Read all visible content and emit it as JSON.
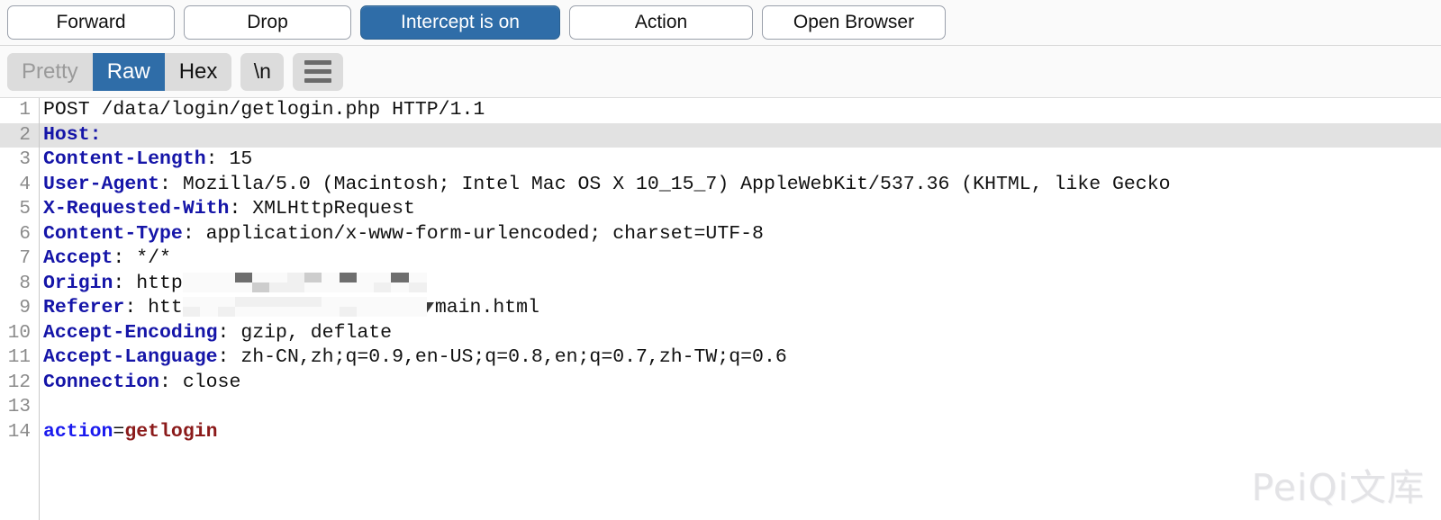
{
  "action_bar": {
    "buttons": [
      {
        "label": "Forward",
        "style": "default"
      },
      {
        "label": "Drop",
        "style": "default"
      },
      {
        "label": "Intercept is on",
        "style": "primary"
      },
      {
        "label": "Action",
        "style": "default"
      },
      {
        "label": "Open Browser",
        "style": "default"
      }
    ]
  },
  "view_bar": {
    "tabs": [
      {
        "label": "Pretty",
        "state": "muted"
      },
      {
        "label": "Raw",
        "state": "active"
      },
      {
        "label": "Hex",
        "state": "normal"
      }
    ],
    "newline_toggle": "\\n",
    "menu_icon": "hamburger-menu-icon"
  },
  "editor": {
    "selected_line": 2,
    "lines": [
      {
        "n": "1",
        "segments": [
          {
            "text": "POST /data/login/getlogin.php HTTP/1.1",
            "class": "plain"
          }
        ]
      },
      {
        "n": "2",
        "segments": [
          {
            "text": "Host:",
            "class": "hdr"
          }
        ]
      },
      {
        "n": "3",
        "segments": [
          {
            "text": "Content-Length",
            "class": "hdr"
          },
          {
            "text": ": 15",
            "class": "plain"
          }
        ]
      },
      {
        "n": "4",
        "segments": [
          {
            "text": "User-Agent",
            "class": "hdr"
          },
          {
            "text": ": Mozilla/5.0 (Macintosh; Intel Mac OS X 10_15_7) AppleWebKit/537.36 (KHTML, like Gecko",
            "class": "plain"
          }
        ]
      },
      {
        "n": "5",
        "segments": [
          {
            "text": "X-Requested-With",
            "class": "hdr"
          },
          {
            "text": ": XMLHttpRequest",
            "class": "plain"
          }
        ]
      },
      {
        "n": "6",
        "segments": [
          {
            "text": "Content-Type",
            "class": "hdr"
          },
          {
            "text": ": application/x-www-form-urlencoded; charset=UTF-8",
            "class": "plain"
          }
        ]
      },
      {
        "n": "7",
        "segments": [
          {
            "text": "Accept",
            "class": "hdr"
          },
          {
            "text": ": */*",
            "class": "plain"
          }
        ]
      },
      {
        "n": "8",
        "segments": [
          {
            "text": "Origin",
            "class": "hdr"
          },
          {
            "text": ": http",
            "class": "plain"
          }
        ],
        "redacted": true
      },
      {
        "n": "9",
        "segments": [
          {
            "text": "Referer",
            "class": "hdr"
          },
          {
            "text": ": htt",
            "class": "plain"
          }
        ],
        "redacted": true,
        "tail": "main.html"
      },
      {
        "n": "10",
        "segments": [
          {
            "text": "Accept-Encoding",
            "class": "hdr"
          },
          {
            "text": ": gzip, deflate",
            "class": "plain"
          }
        ]
      },
      {
        "n": "11",
        "segments": [
          {
            "text": "Accept-Language",
            "class": "hdr"
          },
          {
            "text": ": zh-CN,zh;q=0.9,en-US;q=0.8,en;q=0.7,zh-TW;q=0.6",
            "class": "plain"
          }
        ]
      },
      {
        "n": "12",
        "segments": [
          {
            "text": "Connection",
            "class": "hdr"
          },
          {
            "text": ": close",
            "class": "plain"
          }
        ]
      },
      {
        "n": "13",
        "segments": []
      },
      {
        "n": "14",
        "segments": [
          {
            "text": "action",
            "class": "kw"
          },
          {
            "text": "=",
            "class": "plain"
          },
          {
            "text": "getlogin",
            "class": "val"
          }
        ]
      }
    ]
  },
  "watermark": {
    "text": "PeiQi文库"
  },
  "colors": {
    "accent": "#2f6da8",
    "header_name": "#1515a8",
    "param_key": "#1a1aee",
    "param_value": "#8b1a1a",
    "selected_line_bg": "#e2e2e2",
    "toolbar_bg": "#fafafa",
    "segment_bg": "#dcdcdc"
  }
}
